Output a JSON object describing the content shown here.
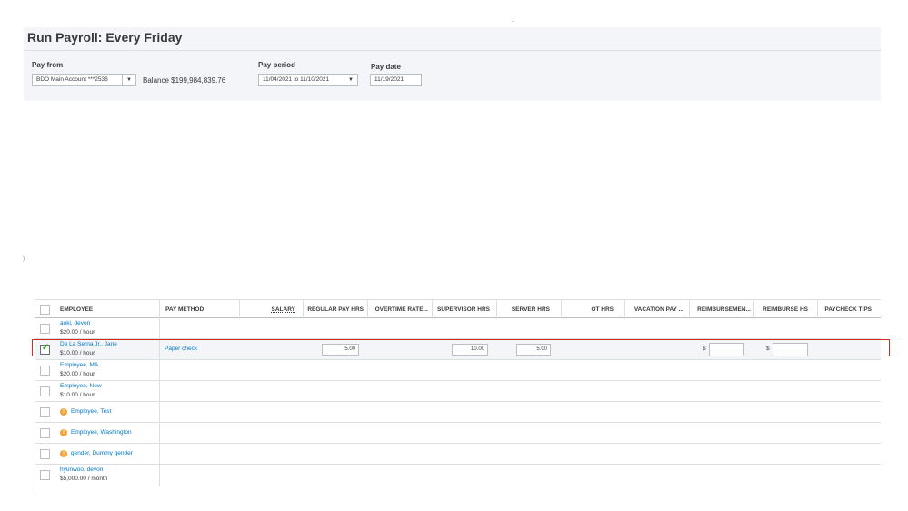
{
  "page": {
    "title": "Run Payroll: Every Friday"
  },
  "header": {
    "pay_from_label": "Pay from",
    "account": "BDO Main Account ***2536",
    "balance": "Balance $199,984,839.76",
    "pay_period_label": "Pay period",
    "pay_period": "11/04/2021 to 11/10/2021",
    "pay_date_label": "Pay date",
    "pay_date": "11/19/2021"
  },
  "table": {
    "headers": {
      "employee": "EMPLOYEE",
      "pay_method": "PAY METHOD",
      "salary": "SALARY",
      "regular_pay_hrs": "REGULAR PAY HRS",
      "overtime_rate": "OVERTIME RATE...",
      "supervisor_hrs": "SUPERVISOR HRS",
      "server_hrs": "SERVER HRS",
      "ot_hrs": "OT HRS",
      "vacation_pay": "VACATION PAY ...",
      "reimbursement": "REIMBURSEMEN...",
      "reimburse_hs": "REIMBURSE HS",
      "paycheck_tips": "PAYCHECK TIPS"
    },
    "rows": [
      {
        "name": "aoki, devon",
        "rate": "$20.00 / hour"
      },
      {
        "name": "De La Serna Jr., Jane",
        "rate": "$10.00 / hour",
        "checked": true,
        "pay_method": "Paper check",
        "regular_pay_hrs": "5.00",
        "supervisor_hrs": "10.00",
        "server_hrs": "5.00",
        "currency": "$"
      },
      {
        "name": "Employee, MA",
        "rate": "$20.00 / hour"
      },
      {
        "name": "Employee, New",
        "rate": "$10.00 / hour"
      },
      {
        "name": "Employee, Test",
        "warning": true
      },
      {
        "name": "Employee, Washington",
        "warning": true
      },
      {
        "name": "gender, Dummy gender",
        "warning": true
      },
      {
        "name": "hyunwoo, devon",
        "rate": "$5,000.00 / month"
      }
    ]
  },
  "icons": {
    "warning": "warning-icon",
    "dropdown": "chevron-down-icon",
    "check": "check-icon"
  },
  "colors": {
    "link": "#0077c5",
    "accent_green": "#2ca01c",
    "warning": "#f2a33a",
    "highlight": "#d52b1e"
  }
}
